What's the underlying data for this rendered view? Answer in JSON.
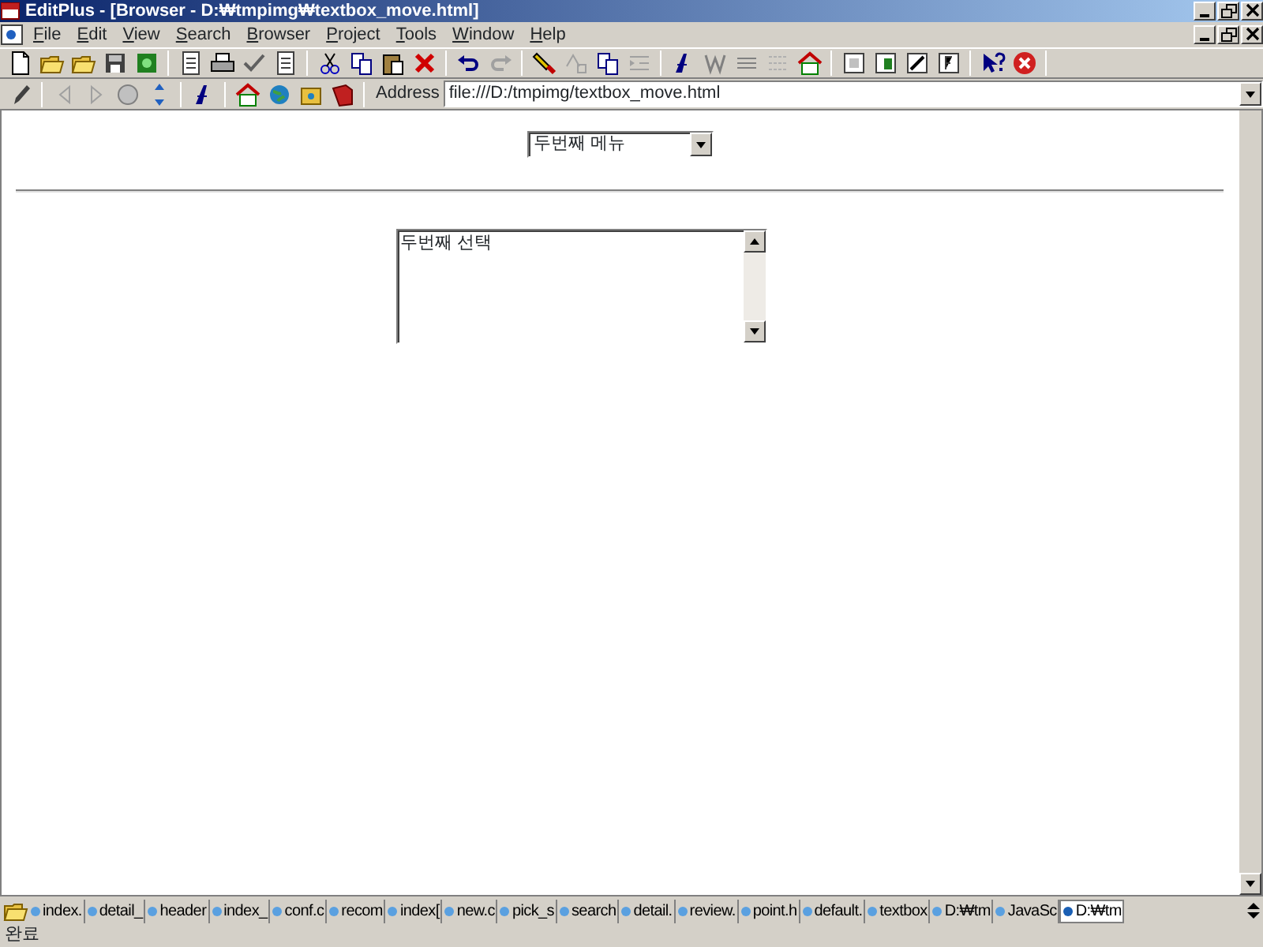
{
  "window": {
    "title": "EditPlus - [Browser - D:₩tmpimg₩textbox_move.html]"
  },
  "menu": [
    {
      "label": "File"
    },
    {
      "label": "Edit"
    },
    {
      "label": "View"
    },
    {
      "label": "Search"
    },
    {
      "label": "Browser"
    },
    {
      "label": "Project"
    },
    {
      "label": "Tools"
    },
    {
      "label": "Window"
    },
    {
      "label": "Help"
    }
  ],
  "address_bar": {
    "label": "Address",
    "value": "file:///D:/tmpimg/textbox_move.html"
  },
  "page": {
    "select_value": "두번째 메뉴",
    "textarea_value": "두번째 선택"
  },
  "file_tabs": [
    {
      "label": "index.",
      "selected": false
    },
    {
      "label": "detail_",
      "selected": false
    },
    {
      "label": "header",
      "selected": false
    },
    {
      "label": "index_",
      "selected": false
    },
    {
      "label": "conf.c",
      "selected": false
    },
    {
      "label": "recom",
      "selected": false
    },
    {
      "label": "index[",
      "selected": false
    },
    {
      "label": "new.c",
      "selected": false
    },
    {
      "label": "pick_s",
      "selected": false
    },
    {
      "label": "search",
      "selected": false
    },
    {
      "label": "detail.",
      "selected": false
    },
    {
      "label": "review.",
      "selected": false
    },
    {
      "label": "point.h",
      "selected": false
    },
    {
      "label": "default.",
      "selected": false
    },
    {
      "label": "textbox",
      "selected": false
    },
    {
      "label": "D:₩tm",
      "selected": false
    },
    {
      "label": "JavaSc",
      "selected": false
    },
    {
      "label": "D:₩tm",
      "selected": true
    }
  ],
  "status_bar": {
    "text": "완료"
  }
}
